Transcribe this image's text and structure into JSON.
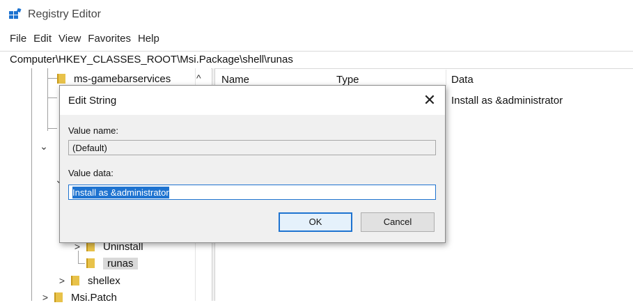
{
  "window": {
    "title": "Registry Editor",
    "colors": {
      "folder": "#e8c24a",
      "accent": "#1e73d0",
      "selection": "#d9d9d9"
    }
  },
  "menu": [
    "File",
    "Edit",
    "View",
    "Favorites",
    "Help"
  ],
  "address": "Computer\\HKEY_CLASSES_ROOT\\Msi.Package\\shell\\runas",
  "tree": {
    "items": [
      {
        "label": "ms-gamebarservices",
        "icon": "folder-icon"
      },
      {
        "label": "Uninstall",
        "icon": "folder-icon",
        "expander": ">"
      },
      {
        "label": "runas",
        "icon": "folder-icon",
        "selected": true
      },
      {
        "label": "shellex",
        "icon": "folder-icon",
        "expander": ">"
      },
      {
        "label": "Msi.Patch",
        "icon": "folder-icon",
        "expander": ">"
      }
    ],
    "collapse_glyph": "⌄",
    "scroll_up_glyph": "^"
  },
  "list": {
    "columns": [
      "Name",
      "Type",
      "Data"
    ],
    "rows": [
      {
        "data": "Install as &administrator"
      }
    ]
  },
  "dialog": {
    "title": "Edit String",
    "close_glyph": "✕",
    "value_name_label": "Value name:",
    "value_name": "(Default)",
    "value_data_label": "Value data:",
    "value_data": "Install as &administrator",
    "ok_label": "OK",
    "cancel_label": "Cancel"
  }
}
